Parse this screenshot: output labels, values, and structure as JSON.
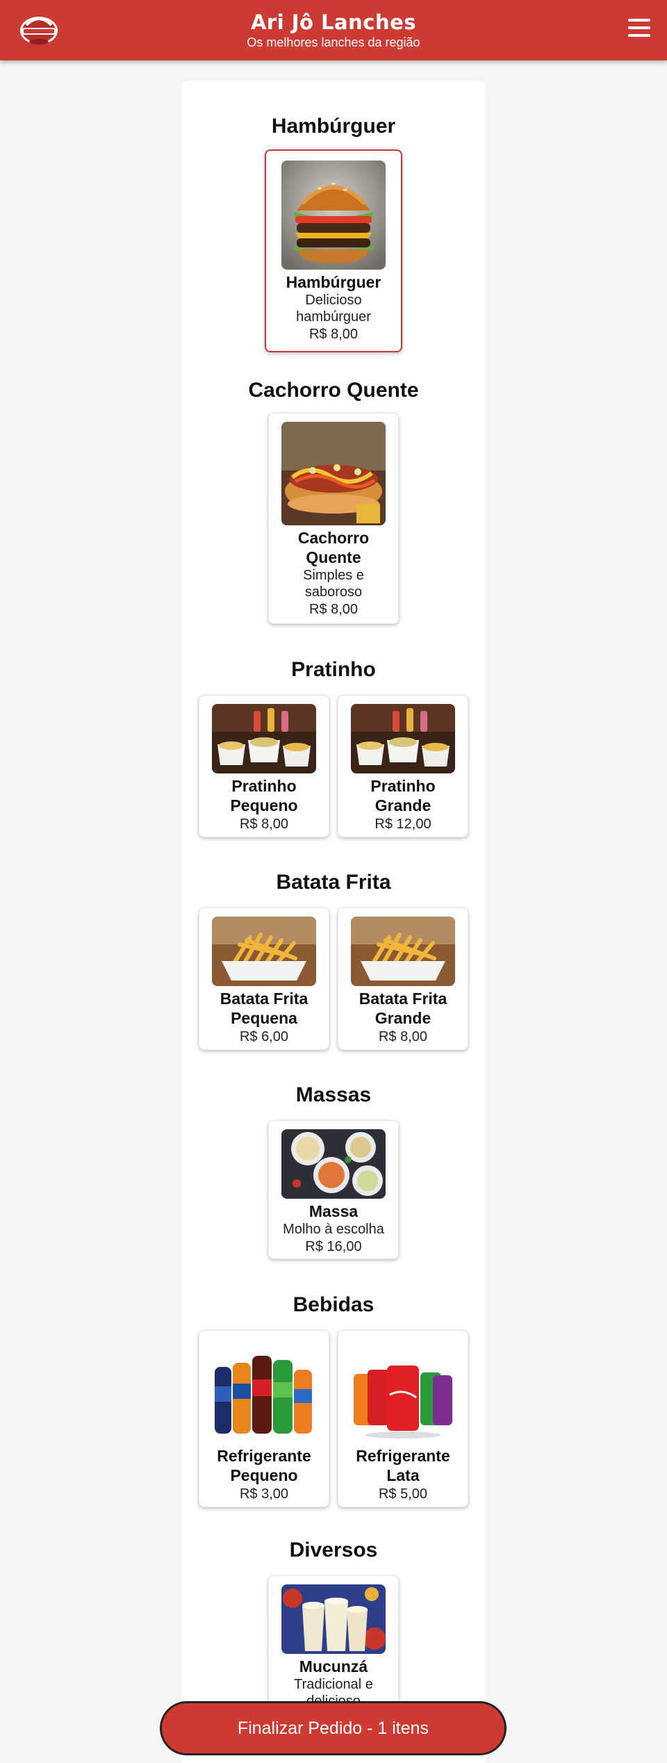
{
  "header": {
    "logo_text": "ARI JÔ LANCHES",
    "title": "Ari Jô Lanches",
    "subtitle": "Os melhores lanches da região"
  },
  "sections": [
    {
      "title": "Hambúrguer",
      "items": [
        {
          "name": "Hambúrguer",
          "desc": "Delicioso hambúrguer",
          "price": "R$ 8,00",
          "image": "burger"
        }
      ]
    },
    {
      "title": "Cachorro Quente",
      "items": [
        {
          "name": "Cachorro Quente",
          "desc": "Simples e saboroso",
          "price": "R$ 8,00",
          "image": "hotdog"
        }
      ]
    },
    {
      "title": "Pratinho",
      "items": [
        {
          "name": "Pratinho Pequeno",
          "desc": "",
          "price": "R$ 8,00",
          "image": "plates"
        },
        {
          "name": "Pratinho Grande",
          "desc": "",
          "price": "R$ 12,00",
          "image": "plates"
        }
      ]
    },
    {
      "title": "Batata Frita",
      "items": [
        {
          "name": "Batata Frita Pequena",
          "desc": "",
          "price": "R$ 6,00",
          "image": "fries"
        },
        {
          "name": "Batata Frita Grande",
          "desc": "",
          "price": "R$ 8,00",
          "image": "fries"
        }
      ]
    },
    {
      "title": "Massas",
      "items": [
        {
          "name": "Massa",
          "desc": "Molho à escolha",
          "price": "R$ 16,00",
          "image": "pasta"
        }
      ]
    },
    {
      "title": "Bebidas",
      "items": [
        {
          "name": "Refrigerante Pequeno",
          "desc": "",
          "price": "R$ 3,00",
          "image": "bottles"
        },
        {
          "name": "Refrigerante Lata",
          "desc": "",
          "price": "R$ 5,00",
          "image": "cans"
        }
      ]
    },
    {
      "title": "Diversos",
      "items": [
        {
          "name": "Mucunzá",
          "desc": "Tradicional e delicioso",
          "price": "",
          "image": "mucunza"
        }
      ]
    }
  ],
  "cart": {
    "finalize_label": "Finalizar Pedido - 1 itens"
  },
  "colors": {
    "brand": "#cd3a33",
    "background": "#f5f5f5"
  }
}
